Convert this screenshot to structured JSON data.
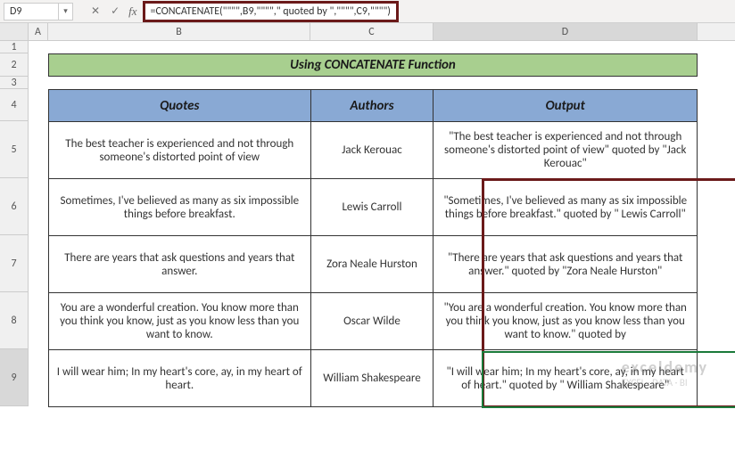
{
  "nameBox": "D9",
  "formulaBar": "=CONCATENATE(\"\"\"\",B9,\"\"\"\",\" quoted by  \",\"\"\"\",C9,\"\"\"\")",
  "columns": [
    "A",
    "B",
    "C",
    "D"
  ],
  "rowNumbers": [
    "1",
    "2",
    "3",
    "4",
    "5",
    "6",
    "7",
    "8",
    "9"
  ],
  "title": "Using CONCATENATE Function",
  "headers": {
    "quotes": "Quotes",
    "authors": "Authors",
    "output": "Output"
  },
  "rows": [
    {
      "quote": "The best teacher is experienced and not through someone's distorted point of view",
      "author": "Jack Kerouac",
      "output": "\"The best teacher is experienced and not through someone's distorted point of view\" quoted by  \"Jack Kerouac\""
    },
    {
      "quote": "Sometimes, I've believed as many as six impossible things before breakfast.",
      "author": "Lewis Carroll",
      "output": "\"Sometimes, I've believed as many as six impossible things before breakfast.\" quoted by  \" Lewis Carroll\""
    },
    {
      "quote": "There are years that ask questions and years that answer.",
      "author": "Zora Neale Hurston",
      "output": "\"There are years that ask questions and years that answer.\" quoted by  \"Zora Neale Hurston\""
    },
    {
      "quote": "You are a wonderful creation. You know more than you think you know, just as you know less than you want to know.",
      "author": "Oscar Wilde",
      "output": "\"You are a wonderful creation. You know more than you think you know, just as you know less than you want to know.\" quoted by"
    },
    {
      "quote": "I will wear him; In my heart's core, ay, in my heart of heart.",
      "author": "William Shakespeare",
      "output": "\"I will wear him; In my heart's core, ay, in my heart of heart.\" quoted by  \" William Shakespeare\""
    }
  ],
  "watermark": {
    "brand": "exceldemy",
    "tag": "EXCEL · DATA · BI"
  },
  "chart_data": {
    "type": "table",
    "title": "Using CONCATENATE Function",
    "columns": [
      "Quotes",
      "Authors",
      "Output"
    ],
    "rows": [
      [
        "The best teacher is experienced and not through someone's distorted point of view",
        "Jack Kerouac",
        "\"The best teacher is experienced and not through someone's distorted point of view\" quoted by  \"Jack Kerouac\""
      ],
      [
        "Sometimes, I've believed as many as six impossible things before breakfast.",
        "Lewis Carroll",
        "\"Sometimes, I've believed as many as six impossible things before breakfast.\" quoted by  \" Lewis Carroll\""
      ],
      [
        "There are years that ask questions and years that answer.",
        "Zora Neale Hurston",
        "\"There are years that ask questions and years that answer.\" quoted by  \"Zora Neale Hurston\""
      ],
      [
        "You are a wonderful creation. You know more than you think you know, just as you know less than you want to know.",
        "Oscar Wilde",
        "\"You are a wonderful creation. You know more than you think you know, just as you know less than you want to know.\" quoted by"
      ],
      [
        "I will wear him; In my heart's core, ay, in my heart of heart.",
        "William Shakespeare",
        "\"I will wear him; In my heart's core, ay, in my heart of heart.\" quoted by  \" William Shakespeare\""
      ]
    ]
  }
}
